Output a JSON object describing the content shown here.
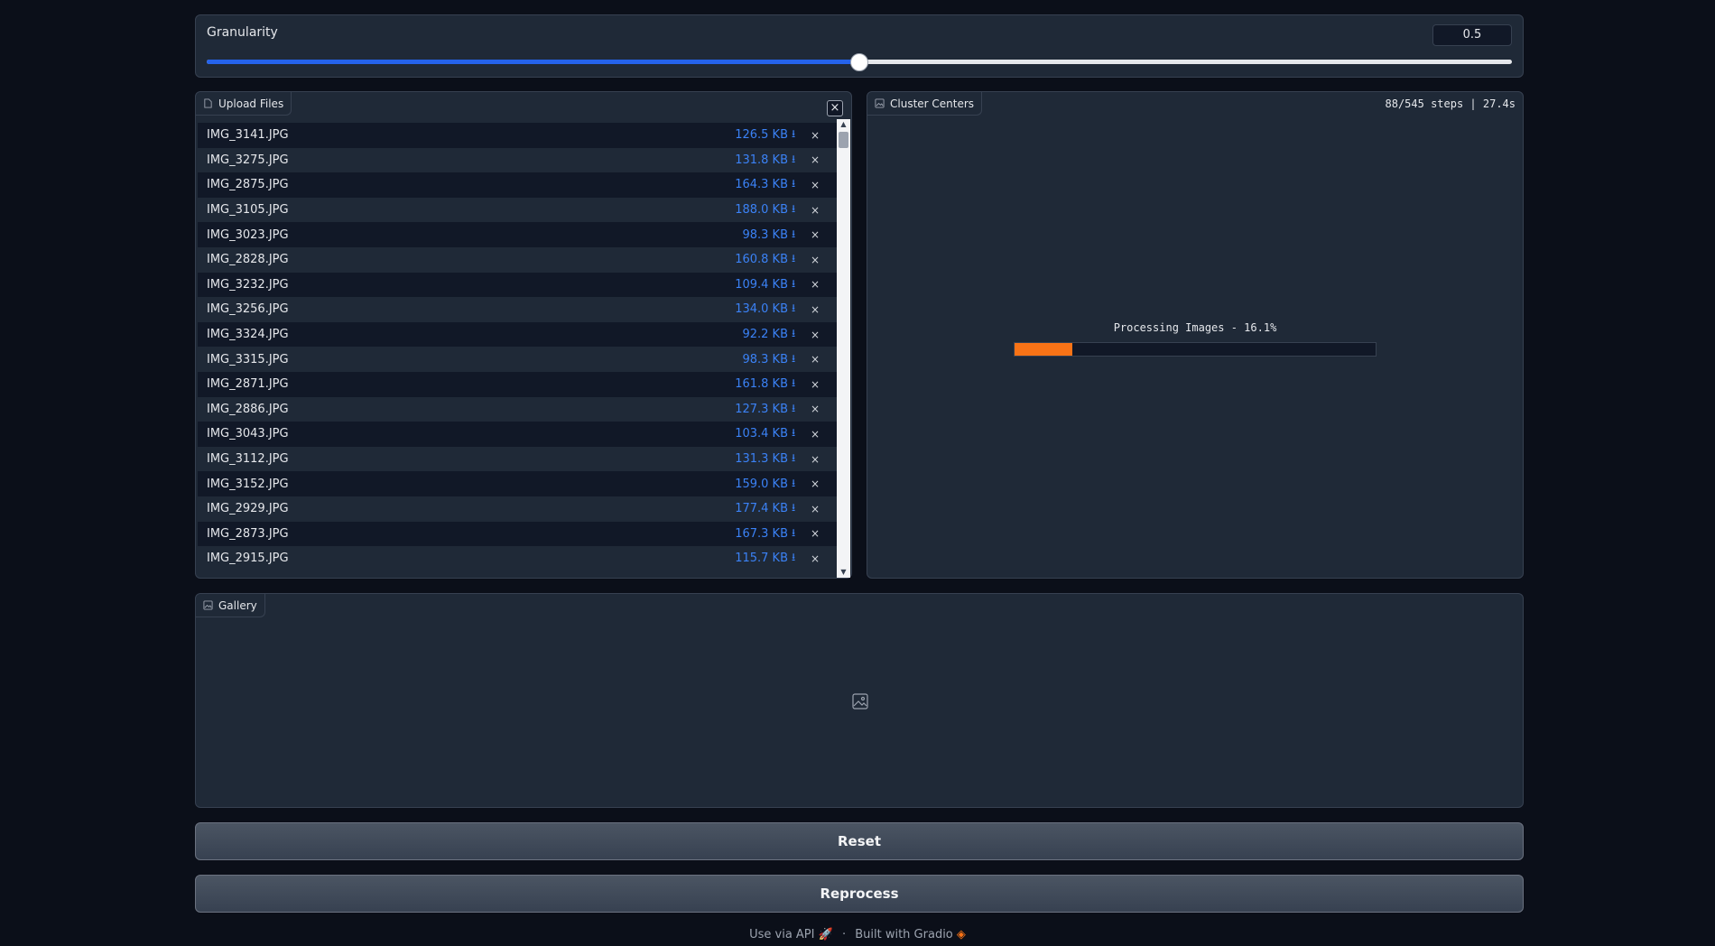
{
  "granularity": {
    "label": "Granularity",
    "value": "0.5",
    "fraction": 0.5
  },
  "upload": {
    "label": "Upload Files",
    "close": "×",
    "files": [
      {
        "name": "IMG_3141.JPG",
        "size": "126.5 KB"
      },
      {
        "name": "IMG_3275.JPG",
        "size": "131.8 KB"
      },
      {
        "name": "IMG_2875.JPG",
        "size": "164.3 KB"
      },
      {
        "name": "IMG_3105.JPG",
        "size": "188.0 KB"
      },
      {
        "name": "IMG_3023.JPG",
        "size": "98.3 KB"
      },
      {
        "name": "IMG_2828.JPG",
        "size": "160.8 KB"
      },
      {
        "name": "IMG_3232.JPG",
        "size": "109.4 KB"
      },
      {
        "name": "IMG_3256.JPG",
        "size": "134.0 KB"
      },
      {
        "name": "IMG_3324.JPG",
        "size": "92.2 KB"
      },
      {
        "name": "IMG_3315.JPG",
        "size": "98.3 KB"
      },
      {
        "name": "IMG_2871.JPG",
        "size": "161.8 KB"
      },
      {
        "name": "IMG_2886.JPG",
        "size": "127.3 KB"
      },
      {
        "name": "IMG_3043.JPG",
        "size": "103.4 KB"
      },
      {
        "name": "IMG_3112.JPG",
        "size": "131.3 KB"
      },
      {
        "name": "IMG_3152.JPG",
        "size": "159.0 KB"
      },
      {
        "name": "IMG_2929.JPG",
        "size": "177.4 KB"
      },
      {
        "name": "IMG_2873.JPG",
        "size": "167.3 KB"
      },
      {
        "name": "IMG_2915.JPG",
        "size": "115.7 KB"
      }
    ],
    "download_glyph": "⭳",
    "remove_glyph": "×"
  },
  "cluster": {
    "label": "Cluster Centers",
    "status": "88/545 steps | 27.4s",
    "progress_text": "Processing Images - 16.1%",
    "progress": 0.161,
    "progress_color": "#f97316"
  },
  "gallery": {
    "label": "Gallery"
  },
  "buttons": {
    "reset": "Reset",
    "reprocess": "Reprocess"
  },
  "footer": {
    "api": "Use via API",
    "sep": "·",
    "built": "Built with Gradio"
  },
  "colors": {
    "accent": "#2563eb",
    "link": "#3b82f6",
    "background": "#0b0f19",
    "panel": "#1f2937"
  },
  "icons": {
    "file": "file-icon",
    "image": "image-icon",
    "rocket": "rocket-icon",
    "gradio": "gradio-logo-icon"
  }
}
